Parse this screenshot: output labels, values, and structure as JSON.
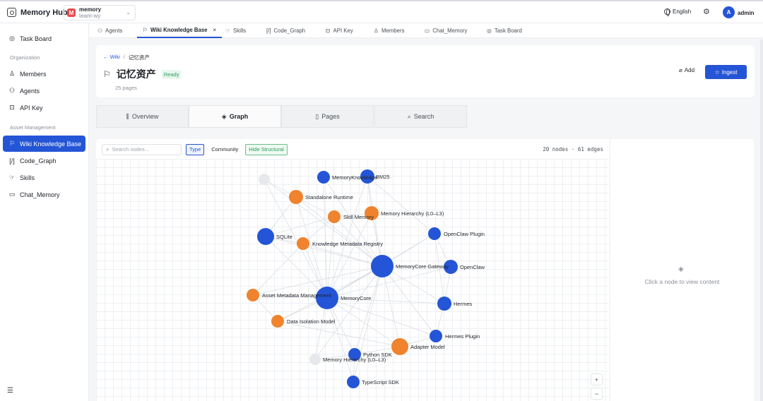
{
  "app": {
    "name": "Memory Hub"
  },
  "team": {
    "avatar": "M",
    "name": "memory",
    "sub": "team-wy"
  },
  "topbar": {
    "language": "English",
    "avatar": "A",
    "user": "admin"
  },
  "sidebar": {
    "items": [
      {
        "label": "Task Board",
        "icon": "board-icon"
      },
      {
        "label": "Members",
        "icon": "user-icon"
      },
      {
        "label": "Agents",
        "icon": "agents-icon"
      },
      {
        "label": "API Key",
        "icon": "lock-icon"
      },
      {
        "label": "Wiki Knowledge Base",
        "icon": "bookmark-icon"
      },
      {
        "label": "Code_Graph",
        "icon": "code-icon"
      },
      {
        "label": "Skills",
        "icon": "skills-icon"
      },
      {
        "label": "Chat_Memory",
        "icon": "chat-icon"
      }
    ],
    "groups": {
      "organization": "Organization",
      "asset_management": "Asset Management"
    }
  },
  "tabs": [
    {
      "label": "Agents",
      "icon": "agents-icon"
    },
    {
      "label": "Wiki Knowledge Base",
      "icon": "bookmark-icon",
      "active": true,
      "close": "×"
    },
    {
      "label": "Skills",
      "icon": "skills-icon"
    },
    {
      "label": "Code_Graph",
      "icon": "code-icon"
    },
    {
      "label": "API Key",
      "icon": "lock-icon"
    },
    {
      "label": "Members",
      "icon": "user-icon"
    },
    {
      "label": "Chat_Memory",
      "icon": "chat-icon"
    },
    {
      "label": "Task Board",
      "icon": "board-icon"
    }
  ],
  "header": {
    "breadcrumb_link": "← Wiki",
    "breadcrumb_sep": "/",
    "breadcrumb_current": "记忆资产",
    "title": "记忆资产",
    "status": "Ready",
    "count": "25 pages",
    "add_label": "Add",
    "ingest_label": "Ingest"
  },
  "view_tabs": [
    {
      "label": "Overview",
      "icon": "chart-icon"
    },
    {
      "label": "Graph",
      "icon": "layers-icon",
      "active": true
    },
    {
      "label": "Pages",
      "icon": "file-icon"
    },
    {
      "label": "Search",
      "icon": "search-icon"
    }
  ],
  "graph": {
    "search_placeholder": "Search nodes...",
    "chips": {
      "type": "Type",
      "community": "Community",
      "structural": "Hide Structural"
    },
    "stats": "20 nodes · 61 edges",
    "colors": {
      "entity": "#2455d6",
      "concept": "#f0832d",
      "structural": "#e6e8ec"
    },
    "nodes": [
      {
        "label": "MemoryKnowledge",
        "kind": "entity"
      },
      {
        "label": "BM25",
        "kind": "entity"
      },
      {
        "label": "",
        "kind": "structural"
      },
      {
        "label": "Standalone Runtime",
        "kind": "concept"
      },
      {
        "label": "Skill Memory",
        "kind": "concept"
      },
      {
        "label": "Memory Hierarchy (L0–L3)",
        "kind": "concept"
      },
      {
        "label": "OpenClaw Plugin",
        "kind": "entity"
      },
      {
        "label": "SQLite",
        "kind": "entity"
      },
      {
        "label": "Knowledge Metadata Registry",
        "kind": "concept"
      },
      {
        "label": "MemoryCore Gateway",
        "kind": "entity"
      },
      {
        "label": "OpenClaw",
        "kind": "entity"
      },
      {
        "label": "Asset Metadata Management",
        "kind": "concept"
      },
      {
        "label": "MemoryCore",
        "kind": "entity"
      },
      {
        "label": "Hermes",
        "kind": "entity"
      },
      {
        "label": "Data Isolation Model",
        "kind": "concept"
      },
      {
        "label": "Hermes Plugin",
        "kind": "entity"
      },
      {
        "label": "Adapter Model",
        "kind": "concept"
      },
      {
        "label": "Python SDK",
        "kind": "entity"
      },
      {
        "label": "Memory Hierarchy (L0–L3)",
        "kind": "structural"
      },
      {
        "label": "TypeScript SDK",
        "kind": "entity"
      }
    ],
    "zoom": {
      "in": "+",
      "out": "−",
      "reset": "⊙"
    }
  },
  "detail": {
    "message": "Click a node to view content",
    "icon": "layers-icon"
  }
}
